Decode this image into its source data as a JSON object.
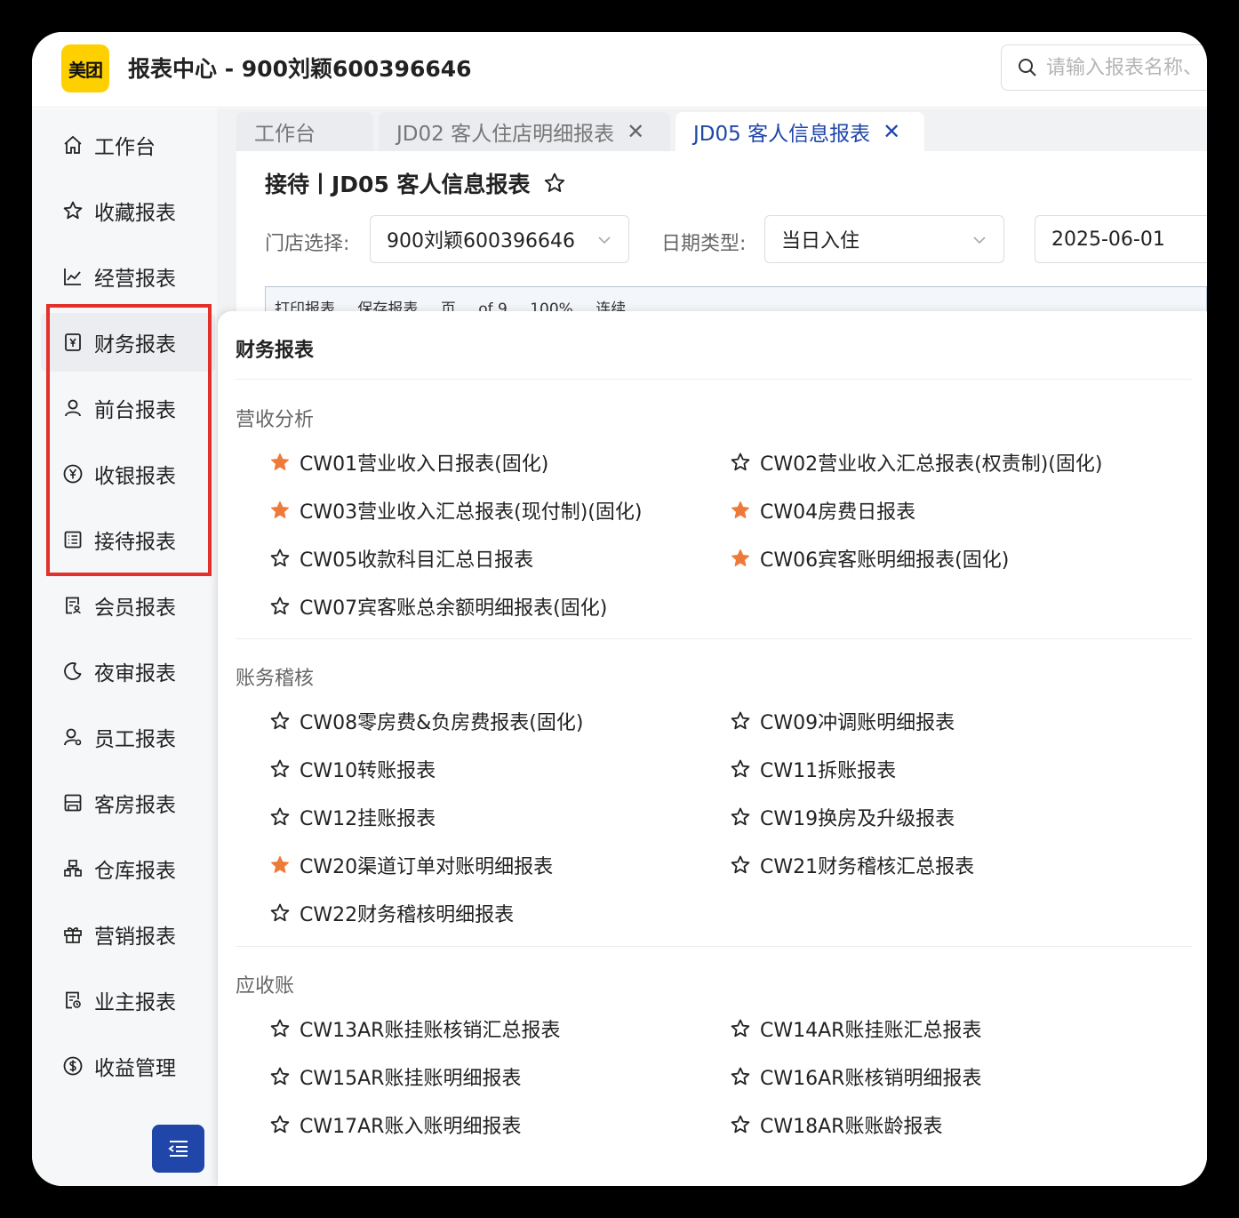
{
  "header": {
    "logo_text": "美团",
    "title": "报表中心 - 900刘颖600396646",
    "search_placeholder": "请输入报表名称、"
  },
  "sidebar": {
    "items": [
      {
        "label": "工作台",
        "icon": "home-icon"
      },
      {
        "label": "收藏报表",
        "icon": "star-icon"
      },
      {
        "label": "经营报表",
        "icon": "line-chart-icon"
      },
      {
        "label": "财务报表",
        "icon": "finance-doc-icon"
      },
      {
        "label": "前台报表",
        "icon": "user-icon"
      },
      {
        "label": "收银报表",
        "icon": "yen-circle-icon"
      },
      {
        "label": "接待报表",
        "icon": "list-doc-icon"
      },
      {
        "label": "会员报表",
        "icon": "member-doc-icon"
      },
      {
        "label": "夜审报表",
        "icon": "moon-icon"
      },
      {
        "label": "员工报表",
        "icon": "staff-icon"
      },
      {
        "label": "客房报表",
        "icon": "room-icon"
      },
      {
        "label": "仓库报表",
        "icon": "warehouse-icon"
      },
      {
        "label": "营销报表",
        "icon": "gift-icon"
      },
      {
        "label": "业主报表",
        "icon": "owner-doc-icon"
      },
      {
        "label": "收益管理",
        "icon": "dollar-circle-icon"
      }
    ],
    "active_item": "财务报表",
    "highlight_color": "#e3302b"
  },
  "tabs": [
    {
      "label": "工作台",
      "closable": false
    },
    {
      "label": "JD02 客人住店明细报表",
      "closable": true
    },
    {
      "label": "JD05 客人信息报表",
      "closable": true,
      "active": true
    }
  ],
  "page": {
    "title": "接待丨JD05 客人信息报表",
    "store_label": "门店选择:",
    "store_value": "900刘颖600396646",
    "date_type_label": "日期类型:",
    "date_type_value": "当日入住",
    "date_value": "2025-06-01",
    "toolbar": {
      "print": "打印报表",
      "save": "保存报表",
      "page_label": "页",
      "page_total": "of 9",
      "zoom": "100%",
      "continuous": "连续"
    }
  },
  "panel": {
    "title": "财务报表",
    "sections": [
      {
        "title": "营收分析",
        "reports": [
          {
            "name": "CW01营业收入日报表(固化)",
            "favorite": true
          },
          {
            "name": "CW02营业收入汇总报表(权责制)(固化)",
            "favorite": false
          },
          {
            "name": "CW03营业收入汇总报表(现付制)(固化)",
            "favorite": true
          },
          {
            "name": "CW04房费日报表",
            "favorite": true
          },
          {
            "name": "CW05收款科目汇总日报表",
            "favorite": false
          },
          {
            "name": "CW06宾客账明细报表(固化)",
            "favorite": true
          },
          {
            "name": "CW07宾客账总余额明细报表(固化)",
            "favorite": false
          }
        ]
      },
      {
        "title": "账务稽核",
        "reports": [
          {
            "name": "CW08零房费&负房费报表(固化)",
            "favorite": false
          },
          {
            "name": "CW09冲调账明细报表",
            "favorite": false
          },
          {
            "name": "CW10转账报表",
            "favorite": false
          },
          {
            "name": "CW11拆账报表",
            "favorite": false
          },
          {
            "name": "CW12挂账报表",
            "favorite": false
          },
          {
            "name": "CW19换房及升级报表",
            "favorite": false
          },
          {
            "name": "CW20渠道订单对账明细报表",
            "favorite": true
          },
          {
            "name": "CW21财务稽核汇总报表",
            "favorite": false
          },
          {
            "name": "CW22财务稽核明细报表",
            "favorite": false
          }
        ]
      },
      {
        "title": "应收账",
        "reports": [
          {
            "name": "CW13AR账挂账核销汇总报表",
            "favorite": false
          },
          {
            "name": "CW14AR账挂账汇总报表",
            "favorite": false
          },
          {
            "name": "CW15AR账挂账明细报表",
            "favorite": false
          },
          {
            "name": "CW16AR账核销明细报表",
            "favorite": false
          },
          {
            "name": "CW17AR账入账明细报表",
            "favorite": false
          },
          {
            "name": "CW18AR账账龄报表",
            "favorite": false
          }
        ]
      }
    ]
  },
  "colors": {
    "accent": "#1f46a8",
    "favorite_star": "#ee7a3a",
    "brand_yellow": "#ffd000"
  }
}
